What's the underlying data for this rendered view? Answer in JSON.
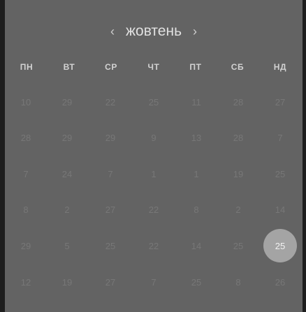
{
  "calendar": {
    "month": "жовтень",
    "prev_icon": "‹",
    "next_icon": "›",
    "weekdays": [
      "ПН",
      "ВТ",
      "СР",
      "ЧТ",
      "ПТ",
      "СБ",
      "НД"
    ],
    "weeks": [
      [
        "10",
        "29",
        "22",
        "25",
        "11",
        "28",
        "27"
      ],
      [
        "28",
        "29",
        "29",
        "9",
        "13",
        "28",
        "7"
      ],
      [
        "7",
        "24",
        "7",
        "1",
        "1",
        "19",
        "25"
      ],
      [
        "8",
        "2",
        "27",
        "22",
        "8",
        "2",
        "14"
      ],
      [
        "29",
        "5",
        "25",
        "22",
        "14",
        "25",
        "25"
      ],
      [
        "12",
        "19",
        "27",
        "7",
        "25",
        "8",
        "26"
      ]
    ],
    "selected": {
      "week": 4,
      "day": 6
    },
    "colors": {
      "background": "#636363",
      "frame": "#1e1e1e",
      "muted_day": "#777777",
      "selected_circle": "#a4a4a4"
    }
  }
}
